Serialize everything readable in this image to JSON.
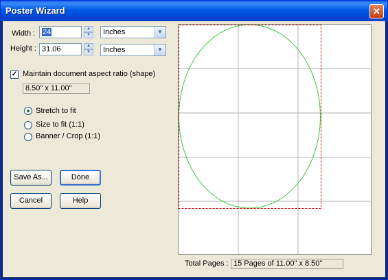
{
  "window": {
    "title": "Poster Wizard"
  },
  "width": {
    "label": "Width :",
    "value": "24",
    "unit": "Inches"
  },
  "height": {
    "label": "Height :",
    "value": "31.06",
    "unit": "Inches"
  },
  "aspect": {
    "label": "Maintain document aspect ratio (shape)",
    "checked": true,
    "size": "8.50\" x 11.00\""
  },
  "options": {
    "stretch": "Stretch to fit",
    "size": "Size to fit  (1:1)",
    "banner": "Banner / Crop (1:1)",
    "selected": "stretch"
  },
  "buttons": {
    "save_as": "Save As...",
    "done": "Done",
    "cancel": "Cancel",
    "help": "Help"
  },
  "status": {
    "label": "Total Pages :",
    "value": "15 Pages of 11.00\" x 8.50\""
  },
  "preview": {
    "columns": 3,
    "rows": 5,
    "page_grid_color": "#b0b0b0",
    "crop_color": "#cc0000",
    "shape_color": "#33cc33"
  }
}
